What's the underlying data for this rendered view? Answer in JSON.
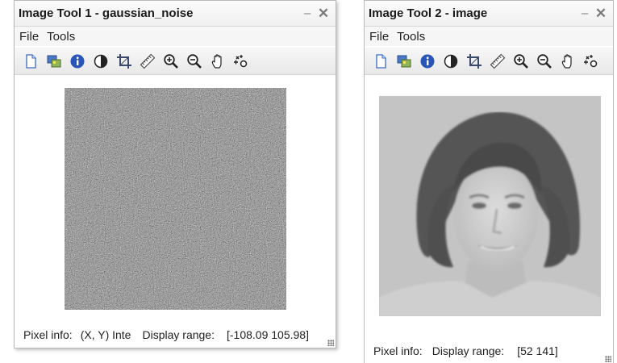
{
  "window1": {
    "title": "Image Tool 1 - gaussian_noise",
    "menu": [
      "File",
      "Tools"
    ],
    "status": {
      "pixel_info_label": "Pixel info:",
      "pixel_info_value": "(X, Y)  Inte",
      "display_range_label": "Display range:",
      "display_range_value": "[-108.09 105.98]"
    }
  },
  "window2": {
    "title": "Image Tool 2 - image",
    "menu": [
      "File",
      "Tools"
    ],
    "status": {
      "pixel_info_label": "Pixel info:",
      "display_range_label": "Display range:",
      "display_range_value": "[52 141]"
    }
  },
  "toolbar_icons": [
    "new-figure-icon",
    "image-info-tool-icon",
    "info-icon",
    "contrast-icon",
    "crop-icon",
    "measure-distance-icon",
    "zoom-in-icon",
    "zoom-out-icon",
    "pan-hand-icon",
    "overview-icon"
  ],
  "window_controls": {
    "minimize": "–",
    "close": "✕"
  },
  "colors": {
    "titlebar": "#f0f0f0",
    "info_icon_blue": "#2a54b8",
    "noise_mid_gray": "#808080"
  }
}
